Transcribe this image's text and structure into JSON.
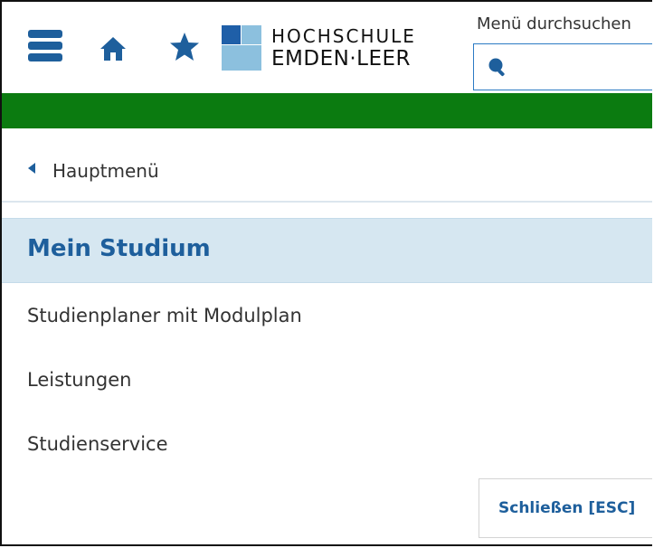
{
  "header": {
    "logo_line1": "HOCHSCHULE",
    "logo_line2": "EMDEN·LEER",
    "search_label": "Menü durchsuchen",
    "search_placeholder": "",
    "icons": [
      "menu-icon",
      "home-icon",
      "star-icon",
      "search-icon"
    ]
  },
  "menu": {
    "back_label": "Hauptmenü",
    "section_title": "Mein Studium",
    "items": [
      {
        "label": "Studienplaner mit Modulplan"
      },
      {
        "label": "Leistungen"
      },
      {
        "label": "Studienservice"
      }
    ],
    "close_label": "Schließen [ESC]"
  },
  "colors": {
    "accent_blue": "#1e5f9c",
    "green_bar": "#0b7b10",
    "section_bg": "#d6e7f1"
  }
}
